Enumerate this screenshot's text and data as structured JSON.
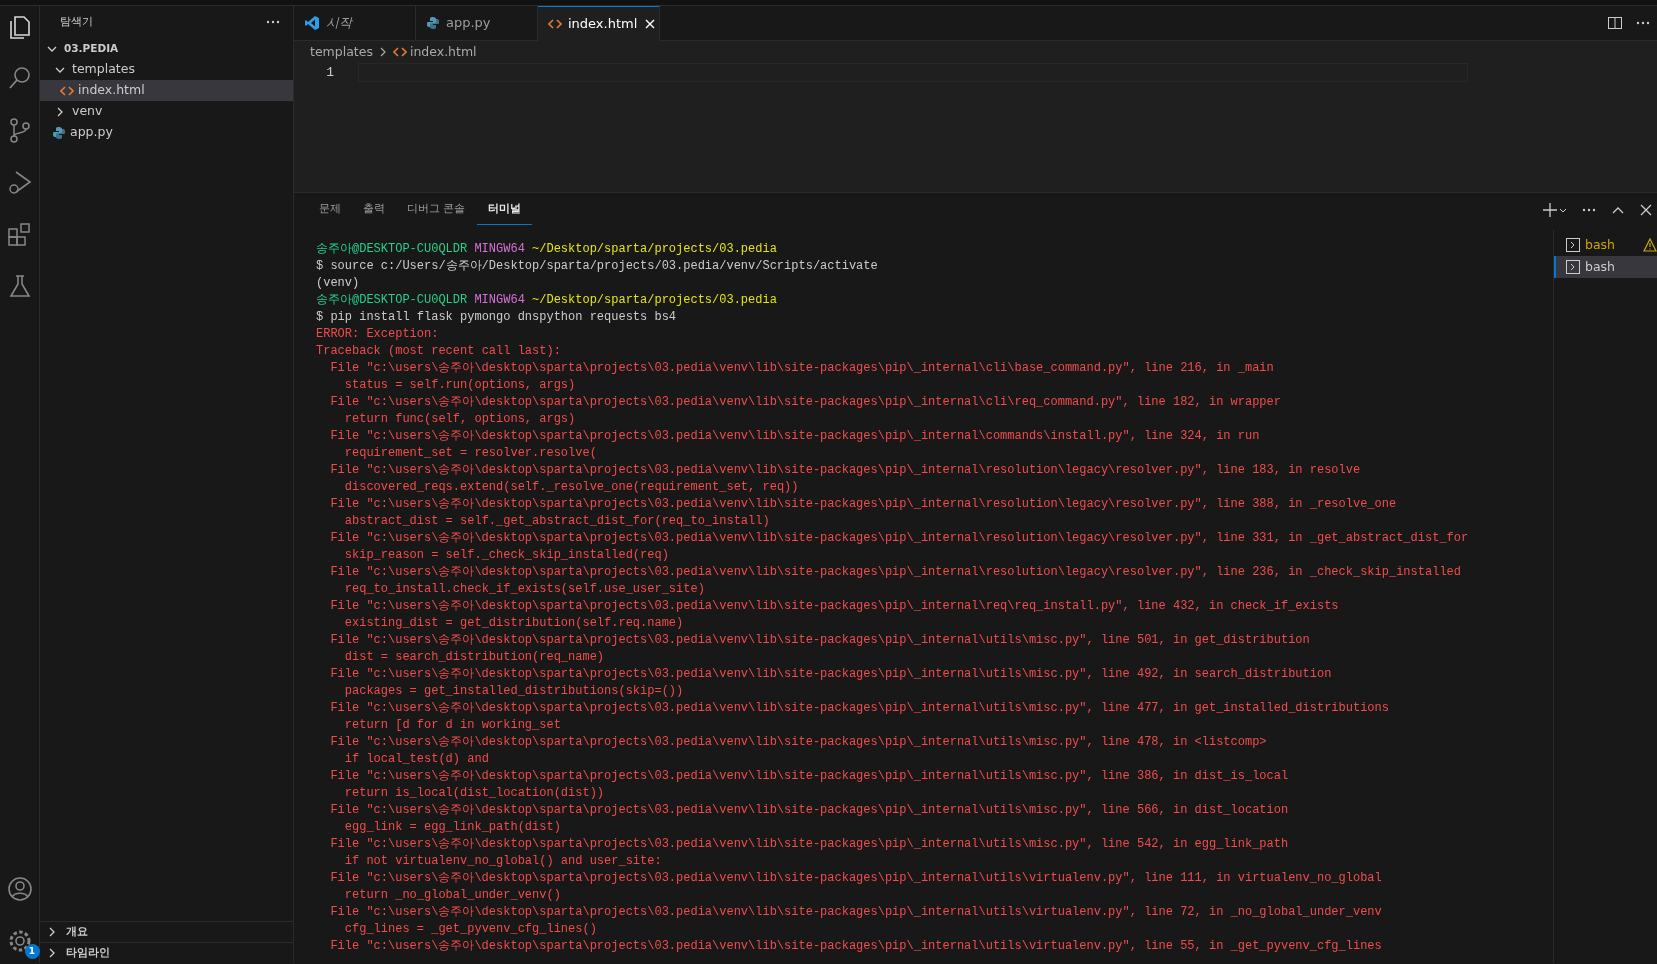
{
  "activity_bar": {
    "items": [
      {
        "kind": "explorer",
        "selected": true
      },
      {
        "kind": "search",
        "selected": false
      },
      {
        "kind": "source_control",
        "selected": false
      },
      {
        "kind": "run_debug",
        "selected": false
      },
      {
        "kind": "extensions",
        "selected": false
      },
      {
        "kind": "testing",
        "selected": false
      }
    ],
    "bottom": [
      {
        "kind": "account"
      },
      {
        "kind": "settings",
        "badge": "1"
      }
    ]
  },
  "sidebar": {
    "title": "탐색기",
    "tree": {
      "label": "03.PEDIA",
      "expanded": true,
      "children": [
        {
          "label": "templates",
          "kind": "folder",
          "expanded": true,
          "selected": false,
          "children": [
            {
              "label": "index.html",
              "kind": "html",
              "selected": true
            }
          ]
        },
        {
          "label": "venv",
          "kind": "folder",
          "expanded": false,
          "selected": false
        },
        {
          "label": "app.py",
          "kind": "python",
          "selected": false
        }
      ]
    },
    "sections": [
      {
        "label": "개요",
        "expanded": false
      },
      {
        "label": "타임라인",
        "expanded": false
      }
    ]
  },
  "editor_tabs": [
    {
      "label": "시작",
      "kind": "welcome",
      "selected": false
    },
    {
      "label": "app.py",
      "kind": "python",
      "selected": false
    },
    {
      "label": "index.html",
      "kind": "html",
      "selected": true
    }
  ],
  "breadcrumb": [
    {
      "label": "templates",
      "kind": "folder"
    },
    {
      "label": "index.html",
      "kind": "html"
    }
  ],
  "editor": {
    "line_numbers": [
      "1"
    ]
  },
  "panel_tabs": [
    {
      "label": "문제",
      "selected": false
    },
    {
      "label": "출력",
      "selected": false
    },
    {
      "label": "디버그 콘솔",
      "selected": false
    },
    {
      "label": "터미널",
      "selected": true
    }
  ],
  "terminal": {
    "lines": [
      {
        "kind": "prompt",
        "user": "송주아",
        "host": "@DESKTOP-CU0QLDR",
        "shell": "MINGW64",
        "path": "~/Desktop/sparta/projects/03.pedia"
      },
      {
        "kind": "command",
        "text": "$ source c:/Users/송주아/Desktop/sparta/projects/03.pedia/venv/Scripts/activate"
      },
      {
        "kind": "command",
        "text": "(venv)"
      },
      {
        "kind": "prompt",
        "user": "송주아",
        "host": "@DESKTOP-CU0QLDR",
        "shell": "MINGW64",
        "path": "~/Desktop/sparta/projects/03.pedia"
      },
      {
        "kind": "command",
        "text": "$ pip install flask pymongo dnspython requests bs4"
      },
      {
        "kind": "error",
        "text": "ERROR: Exception:"
      },
      {
        "kind": "error",
        "text": "Traceback (most recent call last):"
      },
      {
        "kind": "error",
        "text": "  File \"c:\\users\\송주아\\desktop\\sparta\\projects\\03.pedia\\venv\\lib\\site-packages\\pip\\_internal\\cli\\base_command.py\", line 216, in _main"
      },
      {
        "kind": "error",
        "text": "    status = self.run(options, args)"
      },
      {
        "kind": "error",
        "text": "  File \"c:\\users\\송주아\\desktop\\sparta\\projects\\03.pedia\\venv\\lib\\site-packages\\pip\\_internal\\cli\\req_command.py\", line 182, in wrapper"
      },
      {
        "kind": "error",
        "text": "    return func(self, options, args)"
      },
      {
        "kind": "error",
        "text": "  File \"c:\\users\\송주아\\desktop\\sparta\\projects\\03.pedia\\venv\\lib\\site-packages\\pip\\_internal\\commands\\install.py\", line 324, in run"
      },
      {
        "kind": "error",
        "text": "    requirement_set = resolver.resolve("
      },
      {
        "kind": "error",
        "text": "  File \"c:\\users\\송주아\\desktop\\sparta\\projects\\03.pedia\\venv\\lib\\site-packages\\pip\\_internal\\resolution\\legacy\\resolver.py\", line 183, in resolve"
      },
      {
        "kind": "error",
        "text": "    discovered_reqs.extend(self._resolve_one(requirement_set, req))"
      },
      {
        "kind": "error",
        "text": "  File \"c:\\users\\송주아\\desktop\\sparta\\projects\\03.pedia\\venv\\lib\\site-packages\\pip\\_internal\\resolution\\legacy\\resolver.py\", line 388, in _resolve_one"
      },
      {
        "kind": "error",
        "text": "    abstract_dist = self._get_abstract_dist_for(req_to_install)"
      },
      {
        "kind": "error",
        "text": "  File \"c:\\users\\송주아\\desktop\\sparta\\projects\\03.pedia\\venv\\lib\\site-packages\\pip\\_internal\\resolution\\legacy\\resolver.py\", line 331, in _get_abstract_dist_for"
      },
      {
        "kind": "error",
        "text": "    skip_reason = self._check_skip_installed(req)"
      },
      {
        "kind": "error",
        "text": "  File \"c:\\users\\송주아\\desktop\\sparta\\projects\\03.pedia\\venv\\lib\\site-packages\\pip\\_internal\\resolution\\legacy\\resolver.py\", line 236, in _check_skip_installed"
      },
      {
        "kind": "error",
        "text": "    req_to_install.check_if_exists(self.use_user_site)"
      },
      {
        "kind": "error",
        "text": "  File \"c:\\users\\송주아\\desktop\\sparta\\projects\\03.pedia\\venv\\lib\\site-packages\\pip\\_internal\\req\\req_install.py\", line 432, in check_if_exists"
      },
      {
        "kind": "error",
        "text": "    existing_dist = get_distribution(self.req.name)"
      },
      {
        "kind": "error",
        "text": "  File \"c:\\users\\송주아\\desktop\\sparta\\projects\\03.pedia\\venv\\lib\\site-packages\\pip\\_internal\\utils\\misc.py\", line 501, in get_distribution"
      },
      {
        "kind": "error",
        "text": "    dist = search_distribution(req_name)"
      },
      {
        "kind": "error",
        "text": "  File \"c:\\users\\송주아\\desktop\\sparta\\projects\\03.pedia\\venv\\lib\\site-packages\\pip\\_internal\\utils\\misc.py\", line 492, in search_distribution"
      },
      {
        "kind": "error",
        "text": "    packages = get_installed_distributions(skip=())"
      },
      {
        "kind": "error",
        "text": "  File \"c:\\users\\송주아\\desktop\\sparta\\projects\\03.pedia\\venv\\lib\\site-packages\\pip\\_internal\\utils\\misc.py\", line 477, in get_installed_distributions"
      },
      {
        "kind": "error",
        "text": "    return [d for d in working_set"
      },
      {
        "kind": "error",
        "text": "  File \"c:\\users\\송주아\\desktop\\sparta\\projects\\03.pedia\\venv\\lib\\site-packages\\pip\\_internal\\utils\\misc.py\", line 478, in <listcomp>"
      },
      {
        "kind": "error",
        "text": "    if local_test(d) and"
      },
      {
        "kind": "error",
        "text": "  File \"c:\\users\\송주아\\desktop\\sparta\\projects\\03.pedia\\venv\\lib\\site-packages\\pip\\_internal\\utils\\misc.py\", line 386, in dist_is_local"
      },
      {
        "kind": "error",
        "text": "    return is_local(dist_location(dist))"
      },
      {
        "kind": "error",
        "text": "  File \"c:\\users\\송주아\\desktop\\sparta\\projects\\03.pedia\\venv\\lib\\site-packages\\pip\\_internal\\utils\\misc.py\", line 566, in dist_location"
      },
      {
        "kind": "error",
        "text": "    egg_link = egg_link_path(dist)"
      },
      {
        "kind": "error",
        "text": "  File \"c:\\users\\송주아\\desktop\\sparta\\projects\\03.pedia\\venv\\lib\\site-packages\\pip\\_internal\\utils\\misc.py\", line 542, in egg_link_path"
      },
      {
        "kind": "error",
        "text": "    if not virtualenv_no_global() and user_site:"
      },
      {
        "kind": "error",
        "text": "  File \"c:\\users\\송주아\\desktop\\sparta\\projects\\03.pedia\\venv\\lib\\site-packages\\pip\\_internal\\utils\\virtualenv.py\", line 111, in virtualenv_no_global"
      },
      {
        "kind": "error",
        "text": "    return _no_global_under_venv()"
      },
      {
        "kind": "error",
        "text": "  File \"c:\\users\\송주아\\desktop\\sparta\\projects\\03.pedia\\venv\\lib\\site-packages\\pip\\_internal\\utils\\virtualenv.py\", line 72, in _no_global_under_venv"
      },
      {
        "kind": "error",
        "text": "    cfg_lines = _get_pyvenv_cfg_lines()"
      },
      {
        "kind": "error",
        "text": "  File \"c:\\users\\송주아\\desktop\\sparta\\projects\\03.pedia\\venv\\lib\\site-packages\\pip\\_internal\\utils\\virtualenv.py\", line 55, in _get_pyvenv_cfg_lines"
      }
    ]
  },
  "terminal_list": [
    {
      "label": "bash",
      "warning": true,
      "selected": false
    },
    {
      "label": "bash",
      "warning": false,
      "selected": true
    }
  ]
}
